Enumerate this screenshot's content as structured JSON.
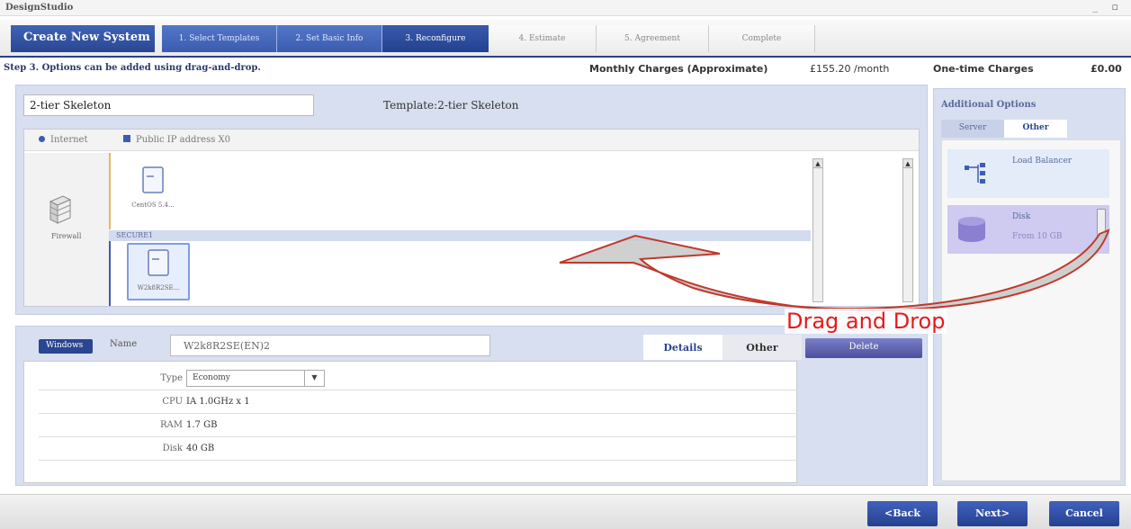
{
  "app": {
    "title": "DesignStudio",
    "window_controls": "_ ▫"
  },
  "wizard": {
    "create_label": "Create New System",
    "steps": [
      {
        "label": "1. Select Templates",
        "state": "done"
      },
      {
        "label": "2. Set Basic Info",
        "state": "done"
      },
      {
        "label": "3. Reconfigure",
        "state": "current"
      },
      {
        "label": "4. Estimate",
        "state": "todo"
      },
      {
        "label": "5. Agreement",
        "state": "todo"
      },
      {
        "label": "Complete",
        "state": "todo"
      }
    ]
  },
  "step_info": {
    "instruction": "Step 3. Options can be added using drag-and-drop.",
    "monthly_label": "Monthly Charges (Approximate)",
    "monthly_value": "£155.20 /month",
    "onetime_label": "One-time Charges",
    "onetime_value": "£0.00"
  },
  "system": {
    "name": "2-tier Skeleton",
    "template_label": "Template:2-tier Skeleton"
  },
  "canvas": {
    "internet_label": "Internet",
    "public_ip_label": "Public IP address X0",
    "firewall_label": "Firewall",
    "segment2_label": "SECURE1",
    "server1_label": "CentOS 5.4...",
    "server2_label": "W2k8R2SE..."
  },
  "details": {
    "os_badge": "Windows",
    "name_label": "Name",
    "name_value": "W2k8R2SE(EN)2",
    "tab_details": "Details",
    "tab_other": "Other",
    "delete_label": "Delete",
    "rows": {
      "type_key": "Type",
      "type_value": "Economy",
      "cpu_key": "CPU",
      "cpu_value": "IA 1.0GHz x 1",
      "ram_key": "RAM",
      "ram_value": "1.7 GB",
      "disk_key": "Disk",
      "disk_value": "40 GB"
    }
  },
  "additional_options": {
    "title": "Additional Options",
    "tab_server": "Server",
    "tab_other": "Other",
    "items": [
      {
        "label": "Load Balancer",
        "sub": ""
      },
      {
        "label": "Disk",
        "sub": "From 10 GB"
      }
    ]
  },
  "annotation": {
    "label": "Drag and Drop"
  },
  "footer": {
    "back": "<Back",
    "next": "Next>",
    "cancel": "Cancel"
  },
  "colors": {
    "accent": "#2a4691",
    "annotation": "#e31b1b"
  }
}
